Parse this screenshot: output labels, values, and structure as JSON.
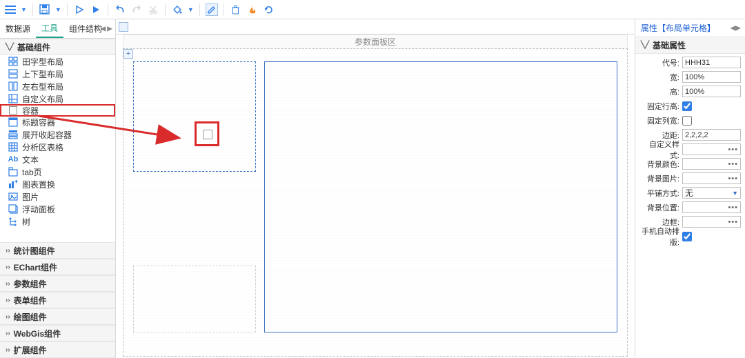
{
  "toolbar": {
    "icons": [
      "menu",
      "save",
      "play-outline",
      "play-solid",
      "undo",
      "redo",
      "cut",
      "bucket",
      "pencil",
      "trash",
      "flame",
      "reload"
    ]
  },
  "leftTabs": {
    "datasource": "数据源",
    "tools": "工具",
    "structure": "组件结构"
  },
  "leftSections": {
    "basic": {
      "title": "基础组件",
      "items": [
        {
          "label": "田字型布局",
          "icon": "grid4"
        },
        {
          "label": "上下型布局",
          "icon": "rows2"
        },
        {
          "label": "左右型布局",
          "icon": "cols2"
        },
        {
          "label": "自定义布局",
          "icon": "customgrid"
        },
        {
          "label": "容器",
          "icon": "box",
          "hl": true
        },
        {
          "label": "标题容器",
          "icon": "titlebox"
        },
        {
          "label": "展开收起容器",
          "icon": "collapsebox"
        },
        {
          "label": "分析区表格",
          "icon": "table"
        },
        {
          "label": "文本",
          "icon": "text"
        },
        {
          "label": "tab页",
          "icon": "tabs"
        },
        {
          "label": "图表置换",
          "icon": "swapchart"
        },
        {
          "label": "图片",
          "icon": "image"
        },
        {
          "label": "浮动面板",
          "icon": "floatpanel"
        },
        {
          "label": "树",
          "icon": "tree"
        }
      ]
    },
    "groups": [
      "统计图组件",
      "EChart组件",
      "参数组件",
      "表单组件",
      "绘图组件",
      "WebGis组件",
      "扩展组件"
    ]
  },
  "canvas": {
    "paramHeader": "参数面板区",
    "plus": "+"
  },
  "rightPanel": {
    "title": "属性【布局单元格】",
    "section": "基础属性",
    "rows": {
      "code": {
        "label": "代号:",
        "value": "HHH31"
      },
      "width": {
        "label": "宽:",
        "value": "100%"
      },
      "height": {
        "label": "高:",
        "value": "100%"
      },
      "fixRowH": {
        "label": "固定行高:",
        "checked": true
      },
      "fixColW": {
        "label": "固定列宽:",
        "checked": false
      },
      "margin": {
        "label": "边距:",
        "value": "2,2,2,2"
      },
      "customStyle": {
        "label": "自定义样式:"
      },
      "bgColor": {
        "label": "背景颜色:"
      },
      "bgImage": {
        "label": "背景图片:"
      },
      "tile": {
        "label": "平铺方式:",
        "value": "无"
      },
      "bgPos": {
        "label": "背景位置:"
      },
      "border": {
        "label": "边框:"
      },
      "mobileAuto": {
        "label": "手机自动排版:",
        "checked": true
      }
    }
  }
}
